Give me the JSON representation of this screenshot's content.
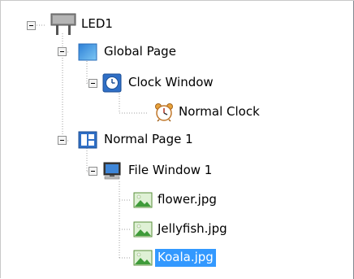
{
  "tree": {
    "nodes": [
      {
        "label": "LED1",
        "icon": "led-screen-icon",
        "expanded": true,
        "selected": false
      },
      {
        "label": "Global Page",
        "icon": "page-icon",
        "expanded": true,
        "selected": false
      },
      {
        "label": "Clock Window",
        "icon": "clock-window-icon",
        "expanded": true,
        "selected": false
      },
      {
        "label": "Normal Clock",
        "icon": "alarm-clock-icon",
        "selected": false
      },
      {
        "label": "Normal Page 1",
        "icon": "page-layout-icon",
        "expanded": true,
        "selected": false
      },
      {
        "label": "File Window 1",
        "icon": "computer-monitor-icon",
        "expanded": true,
        "selected": false
      },
      {
        "label": "flower.jpg",
        "icon": "image-file-icon",
        "selected": false
      },
      {
        "label": "Jellyfish.jpg",
        "icon": "image-file-icon",
        "selected": false
      },
      {
        "label": "Koala.jpg",
        "icon": "image-file-icon",
        "selected": true
      }
    ]
  },
  "colors": {
    "selection": "#3399ff",
    "connector": "#a0a0a0"
  }
}
